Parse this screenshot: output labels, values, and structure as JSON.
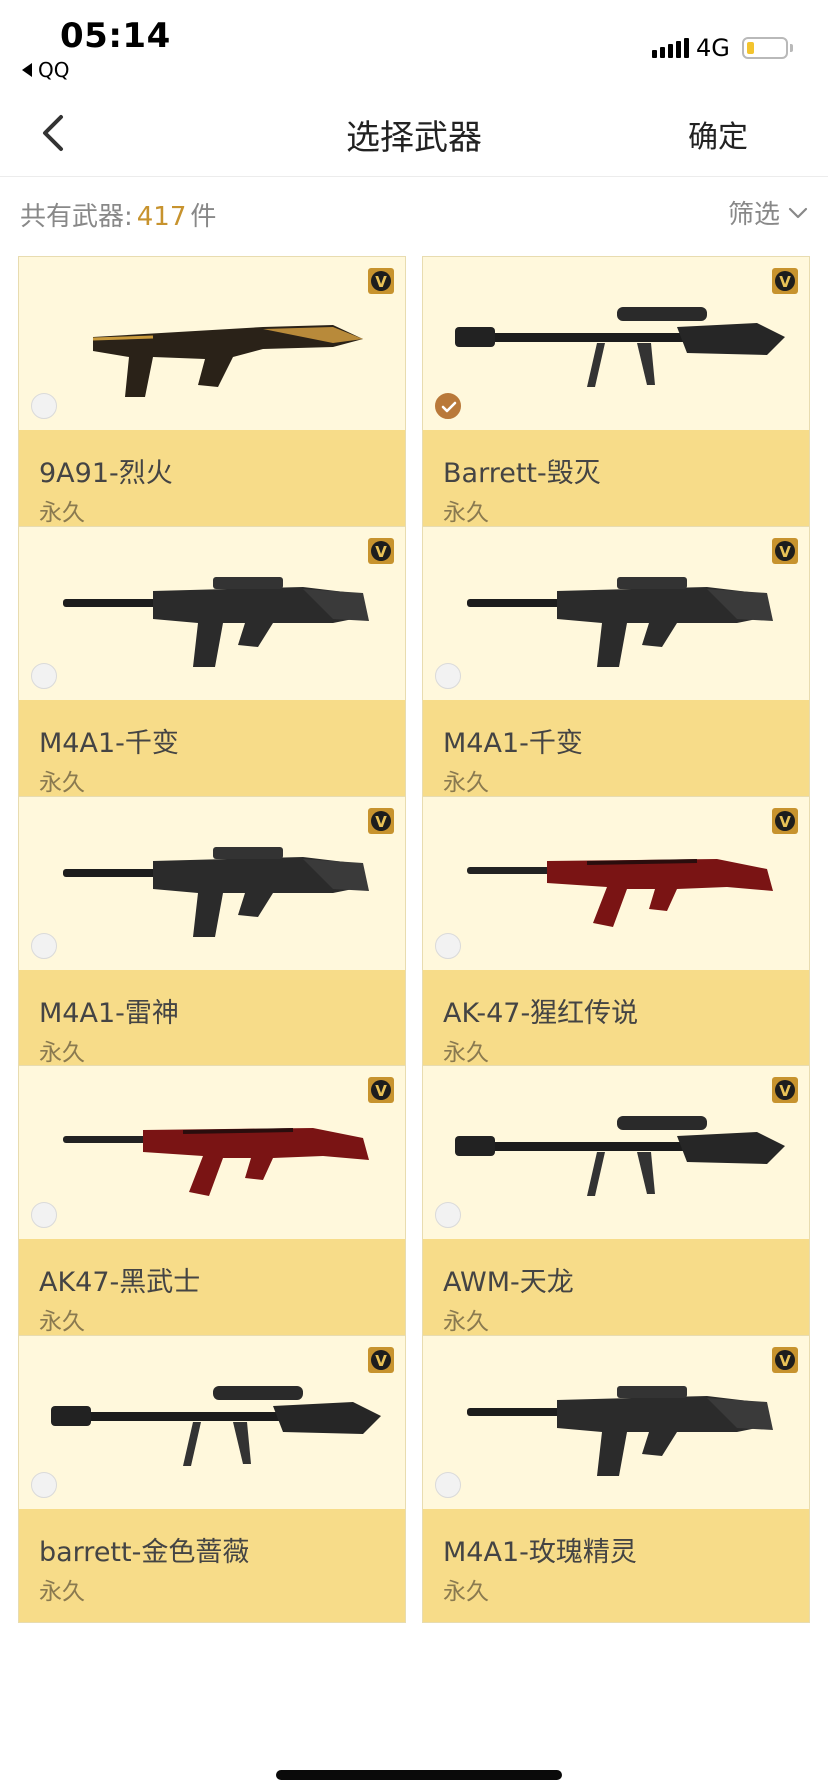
{
  "status_bar": {
    "time": "05:14",
    "back_app": "QQ",
    "network": "4G",
    "battery_level": 0.2
  },
  "nav": {
    "title": "选择武器",
    "confirm": "确定",
    "back_icon": "chevron-left-icon"
  },
  "summary": {
    "prefix": "共有武器:",
    "count": "417",
    "suffix": "件",
    "filter_label": "筛选",
    "filter_icon": "chevron-down-icon"
  },
  "colors": {
    "accent": "#c7932e",
    "card_top": "#fff8dc",
    "card_bottom": "#f7dc89",
    "checked": "#b9793a"
  },
  "weapons": [
    {
      "name": "9A91-烈火",
      "duration": "永久",
      "selected": false,
      "icon": "smg-icon"
    },
    {
      "name": "Barrett-毁灭",
      "duration": "永久",
      "selected": true,
      "icon": "sniper-rifle-icon"
    },
    {
      "name": "M4A1-千变",
      "duration": "永久",
      "selected": false,
      "icon": "assault-rifle-icon"
    },
    {
      "name": "M4A1-千变",
      "duration": "永久",
      "selected": false,
      "icon": "assault-rifle-icon"
    },
    {
      "name": "M4A1-雷神",
      "duration": "永久",
      "selected": false,
      "icon": "assault-rifle-icon"
    },
    {
      "name": "AK-47-猩红传说",
      "duration": "永久",
      "selected": false,
      "icon": "ak-rifle-icon"
    },
    {
      "name": "AK47-黑武士",
      "duration": "永久",
      "selected": false,
      "icon": "ak-rifle-icon"
    },
    {
      "name": "AWM-天龙",
      "duration": "永久",
      "selected": false,
      "icon": "sniper-rifle-icon"
    },
    {
      "name": "barrett-金色蔷薇",
      "duration": "永久",
      "selected": false,
      "icon": "sniper-rifle-icon"
    },
    {
      "name": "M4A1-玫瑰精灵",
      "duration": "永久",
      "selected": false,
      "icon": "assault-rifle-icon"
    }
  ]
}
